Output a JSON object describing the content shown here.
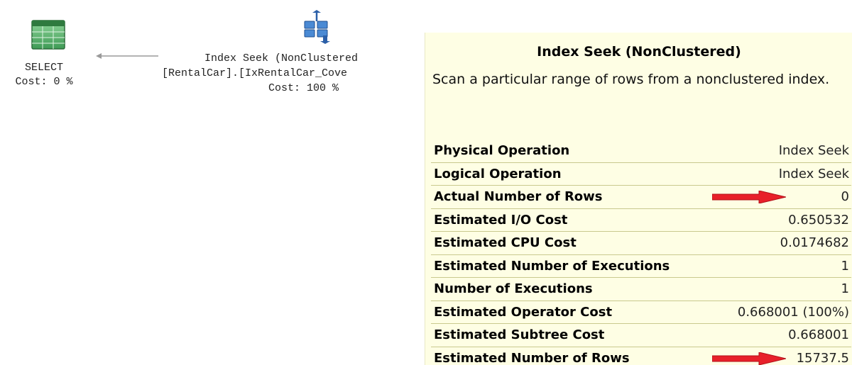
{
  "plan": {
    "select_node": {
      "label": "SELECT",
      "cost": "Cost: 0 %",
      "icon": "result-table-icon"
    },
    "seek_node": {
      "line1": "Index Seek (NonClustered",
      "line2": "[RentalCar].[IxRentalCar_Cove",
      "line3": "Cost: 100 %",
      "icon": "index-seek-icon"
    }
  },
  "tooltip": {
    "title": "Index Seek (NonClustered)",
    "description": "Scan a particular range of rows from a nonclustered index.",
    "rows": [
      {
        "label": "Physical Operation",
        "value": "Index Seek"
      },
      {
        "label": "Logical Operation",
        "value": "Index Seek"
      },
      {
        "label": "Actual Number of Rows",
        "value": "0"
      },
      {
        "label": "Estimated I/O Cost",
        "value": "0.650532"
      },
      {
        "label": "Estimated CPU Cost",
        "value": "0.0174682"
      },
      {
        "label": "Estimated Number of Executions",
        "value": "1"
      },
      {
        "label": "Number of Executions",
        "value": "1"
      },
      {
        "label": "Estimated Operator Cost",
        "value": "0.668001 (100%)"
      },
      {
        "label": "Estimated Subtree Cost",
        "value": "0.668001"
      },
      {
        "label": "Estimated Number of Rows",
        "value": "15737.5"
      }
    ]
  },
  "colors": {
    "tooltip_bg": "#fefee4",
    "row_border": "#c9c98e",
    "annotation_arrow": "#e8202a"
  }
}
